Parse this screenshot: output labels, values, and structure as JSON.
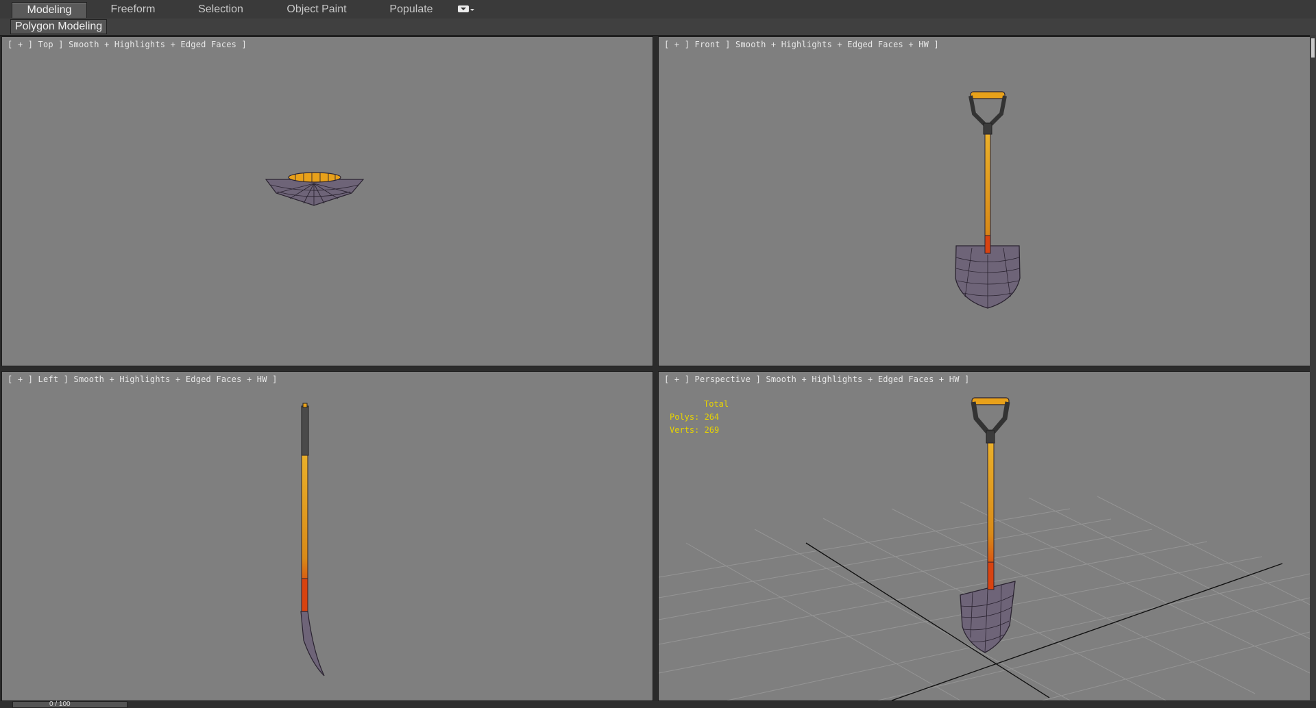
{
  "ribbon": {
    "tabs": [
      {
        "label": "Modeling",
        "active": true
      },
      {
        "label": "Freeform",
        "active": false
      },
      {
        "label": "Selection",
        "active": false
      },
      {
        "label": "Object Paint",
        "active": false
      },
      {
        "label": "Populate",
        "active": false
      }
    ],
    "dropdown_icon": "chevron-down-icon",
    "panel_label": "Polygon Modeling"
  },
  "viewports": {
    "top": {
      "label": "[ + ] Top ] Smooth + Highlights + Edged Faces ]"
    },
    "front": {
      "label": "[ + ] Front ] Smooth + Highlights + Edged Faces + HW ]"
    },
    "left": {
      "label": "[ + ] Left ] Smooth + Highlights + Edged Faces + HW ]"
    },
    "perspective": {
      "label": "[ + ] Perspective ] Smooth + Highlights + Edged Faces + HW ]",
      "stats": {
        "header": "Total",
        "polys": "Polys: 264",
        "verts": "Verts: 269"
      }
    }
  },
  "colors": {
    "viewport_bg": "#7f7f7f",
    "handle_wood": "#e8a11a",
    "blade": "#6e6478",
    "stats_text": "#e8d400"
  },
  "timeline": {
    "label": "0 / 100"
  }
}
